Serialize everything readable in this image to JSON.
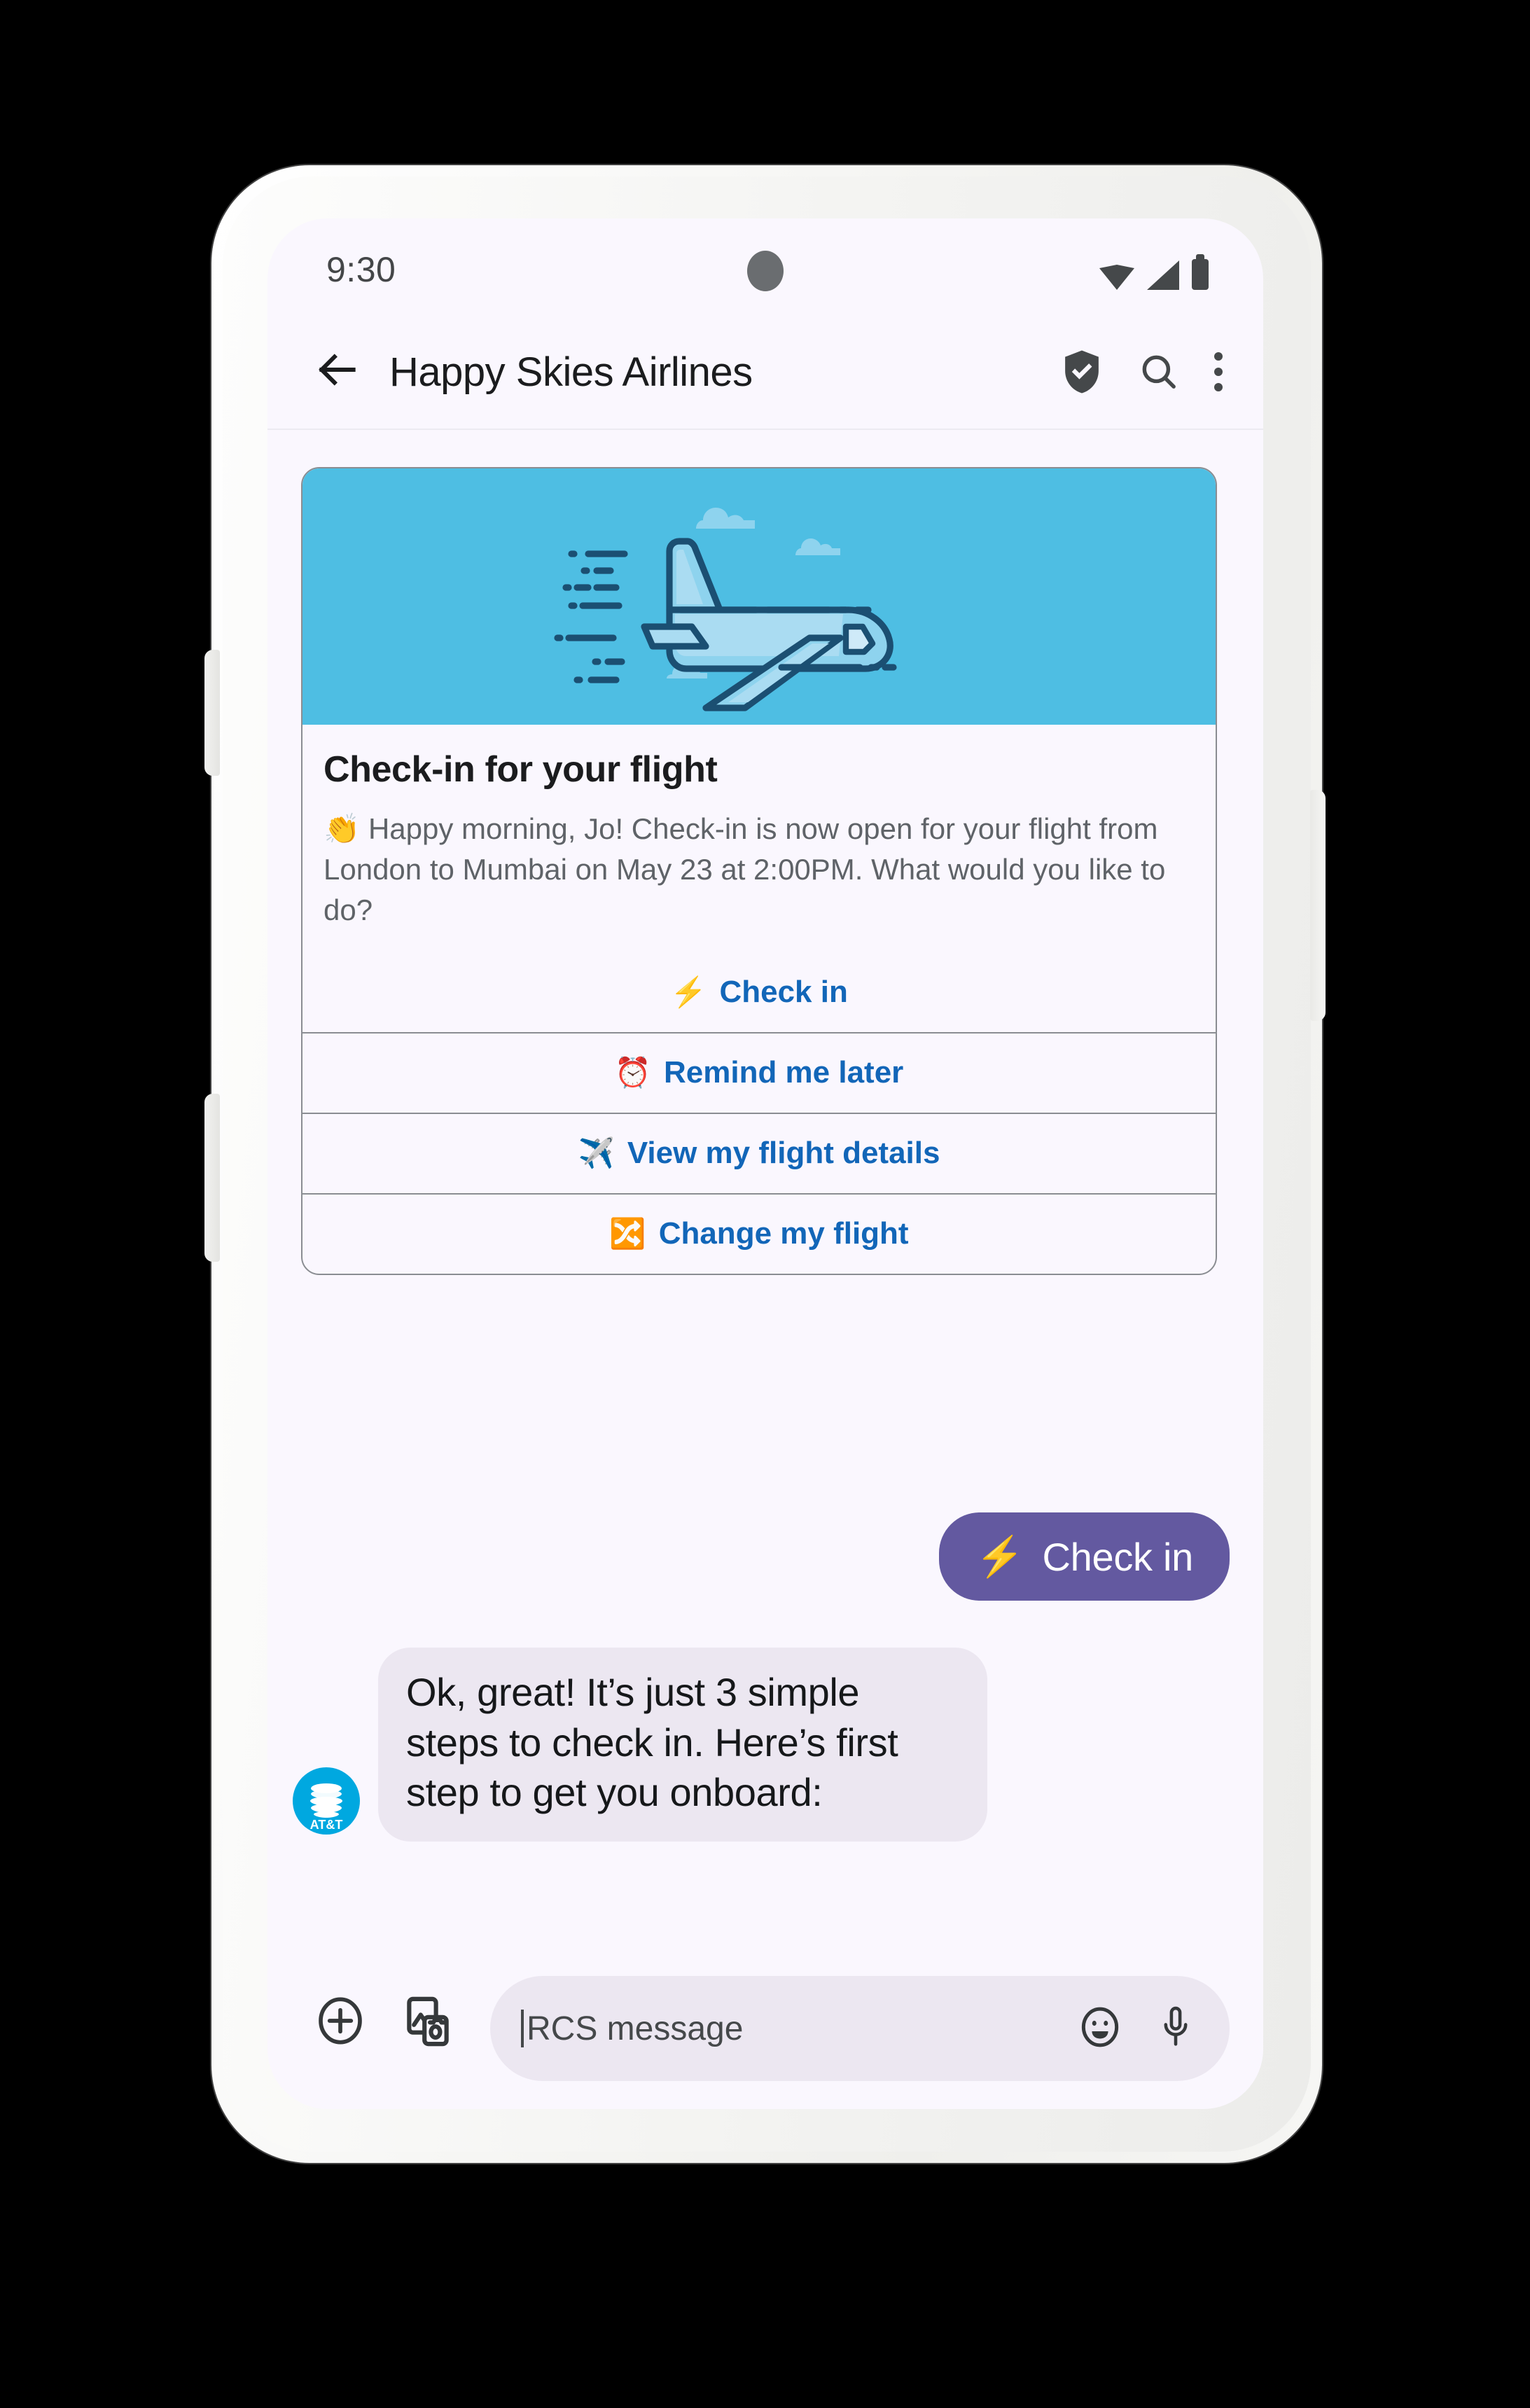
{
  "statusbar": {
    "time": "9:30",
    "icons": [
      "wifi-icon",
      "cellular-signal-icon",
      "battery-icon"
    ]
  },
  "appbar": {
    "back_icon": "back-arrow-icon",
    "title": "Happy Skies Airlines",
    "verified_icon": "shield-check-icon",
    "search_icon": "search-icon",
    "more_icon": "more-vertical-icon"
  },
  "card": {
    "hero_icon": "airplane-illustration",
    "hero_color": "#4ebee3",
    "title": "Check-in for your flight",
    "description": "👏 Happy morning, Jo! Check-in is now open for your flight from London to Mumbai on May 23 at 2:00PM. What would you like to do?",
    "link_color": "#1266b8",
    "actions": [
      {
        "emoji": "⚡",
        "label": "Check in"
      },
      {
        "emoji": "⏰",
        "label": "Remind me later"
      },
      {
        "emoji": "✈️",
        "label": "View my flight details"
      },
      {
        "emoji": "🔀",
        "label": "Change my flight"
      }
    ]
  },
  "messages": {
    "outgoing": {
      "emoji": "⚡",
      "text": "Check in",
      "bubble_color": "#6359a0"
    },
    "incoming": {
      "avatar_label": "AT&T",
      "avatar_color": "#00a8e0",
      "text": "Ok, great! It’s just 3 simple steps to check in. Here’s first step to get you onboard:",
      "bubble_color": "#ece7f1"
    }
  },
  "composer": {
    "add_icon": "plus-circle-icon",
    "gallery_icon": "image-gallery-icon",
    "placeholder": "RCS message",
    "emoji_icon": "emoji-smiley-icon",
    "mic_icon": "microphone-icon"
  }
}
